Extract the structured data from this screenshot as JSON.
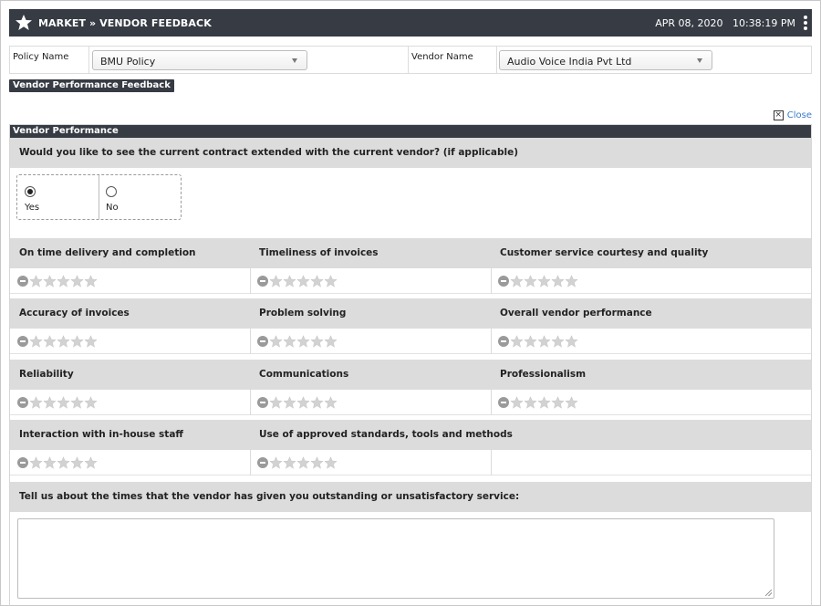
{
  "header": {
    "breadcrumb": "MARKET » VENDOR FEEDBACK",
    "datetime": "APR 08, 2020   10:38:19 PM"
  },
  "filters": {
    "policy_label": "Policy Name",
    "policy_value": "BMU Policy",
    "vendor_label": "Vendor Name",
    "vendor_value": "Audio Voice India Pvt Ltd"
  },
  "section_pill": "Vendor Performance Feedback",
  "close_label": "Close",
  "panel_title": "Vendor Performance",
  "question": {
    "text": "Would you like to see the current contract extended with the current vendor? (if applicable)",
    "options": [
      {
        "label": "Yes",
        "selected": true
      },
      {
        "label": "No",
        "selected": false
      }
    ]
  },
  "ratings": [
    [
      "On time delivery and completion",
      "Timeliness of invoices",
      "Customer service courtesy and quality"
    ],
    [
      "Accuracy of invoices",
      "Problem solving",
      "Overall vendor performance"
    ],
    [
      "Reliability",
      "Communications",
      "Professionalism"
    ],
    [
      "Interaction with in-house staff",
      "Use of approved standards, tools and methods"
    ]
  ],
  "comment_prompt": "Tell us about the times that the vendor has given you outstanding or unsatisfactory service:",
  "colors": {
    "header_bg": "#363b44",
    "row_bg": "#dcdcdc",
    "link": "#3a7bc8"
  }
}
